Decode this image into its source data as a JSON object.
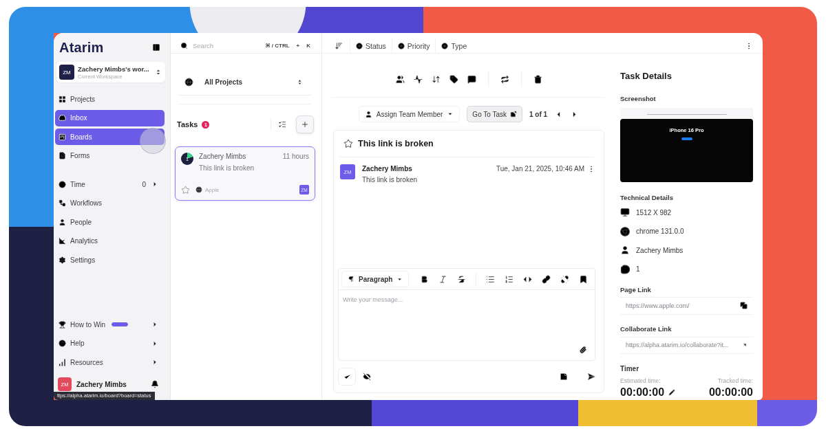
{
  "sidebar": {
    "logo": "Atarim",
    "workspace": {
      "avatar": "ZM",
      "name": "Zachery Mimbs's wor...",
      "subtitle": "Current Workspace"
    },
    "primary_nav": [
      {
        "label": "Projects",
        "selected": false,
        "hovered": false,
        "has_submenu": false
      },
      {
        "label": "Inbox",
        "selected": true,
        "hovered": false,
        "has_submenu": false
      },
      {
        "label": "Boards",
        "selected": false,
        "hovered": true,
        "has_submenu": false
      },
      {
        "label": "Forms",
        "selected": false,
        "hovered": false,
        "has_submenu": false
      }
    ],
    "secondary_nav": [
      {
        "label": "Time",
        "count": "0",
        "selected": false,
        "hovered": false,
        "has_submenu": true
      },
      {
        "label": "Workflows",
        "selected": false,
        "hovered": false,
        "has_submenu": false
      },
      {
        "label": "People",
        "selected": false,
        "hovered": false,
        "has_submenu": false
      },
      {
        "label": "Analytics",
        "selected": false,
        "hovered": false,
        "has_submenu": false
      },
      {
        "label": "Settings",
        "selected": false,
        "hovered": false,
        "has_submenu": false
      }
    ],
    "footer_nav": [
      {
        "label": "How to Win",
        "level": 1,
        "selected": false,
        "hovered": false,
        "has_submenu": true
      },
      {
        "label": "Help",
        "selected": false,
        "hovered": false,
        "has_submenu": true
      },
      {
        "label": "Resources",
        "selected": false,
        "hovered": false,
        "has_submenu": true
      }
    ],
    "user": {
      "avatar": "ZM",
      "name": "Zachery Mimbs"
    }
  },
  "status_url": "ttps://alpha.atarim.io/board?board=status",
  "search": {
    "placeholder": "Search",
    "shortcut": [
      "⌘ / CTRL",
      "+",
      "K"
    ]
  },
  "project_filter": {
    "value": "All Projects"
  },
  "tasks": {
    "title": "Tasks",
    "count": "1",
    "items": [
      {
        "status": "1",
        "author": "Zachery Mimbs",
        "time": "11 hours",
        "summary": "This link is broken",
        "site": "Apple",
        "assignee": "ZM",
        "selected": true,
        "starred": false
      }
    ]
  },
  "filters": [
    "Status",
    "Priority",
    "Type"
  ],
  "task_actions": {
    "assign": "Assign Team Member",
    "go_to": "Go To Task",
    "pager": "1 of 1"
  },
  "task": {
    "title": "This link is broken",
    "starred": false,
    "comments": [
      {
        "avatar": "ZM",
        "author": "Zachery Mimbs",
        "date": "Tue, Jan 21, 2025, 10:46 AM",
        "text": "This link is broken"
      }
    ]
  },
  "editor": {
    "block_type": "Paragraph",
    "placeholder": "Write your message..."
  },
  "details": {
    "title": "Task Details",
    "screenshot": {
      "label": "Screenshot",
      "headline": "iPhone 16 Pro"
    },
    "technical": {
      "label": "Technical Details",
      "rows": [
        "1512 X 982",
        "chrome 131.0.0",
        "Zachery Mimbs",
        "1"
      ]
    },
    "page_link": {
      "label": "Page Link",
      "value": "https://www.apple.com/"
    },
    "collaborate_link": {
      "label": "Collaborate Link",
      "value": "https://alpha.atarim.io/collaborate?it..."
    },
    "timer": {
      "label": "Timer",
      "estimated_label": "Estimated time:",
      "estimated": "00:00:00",
      "tracked_label": "Tracked time:",
      "tracked": "00:00:00"
    }
  }
}
